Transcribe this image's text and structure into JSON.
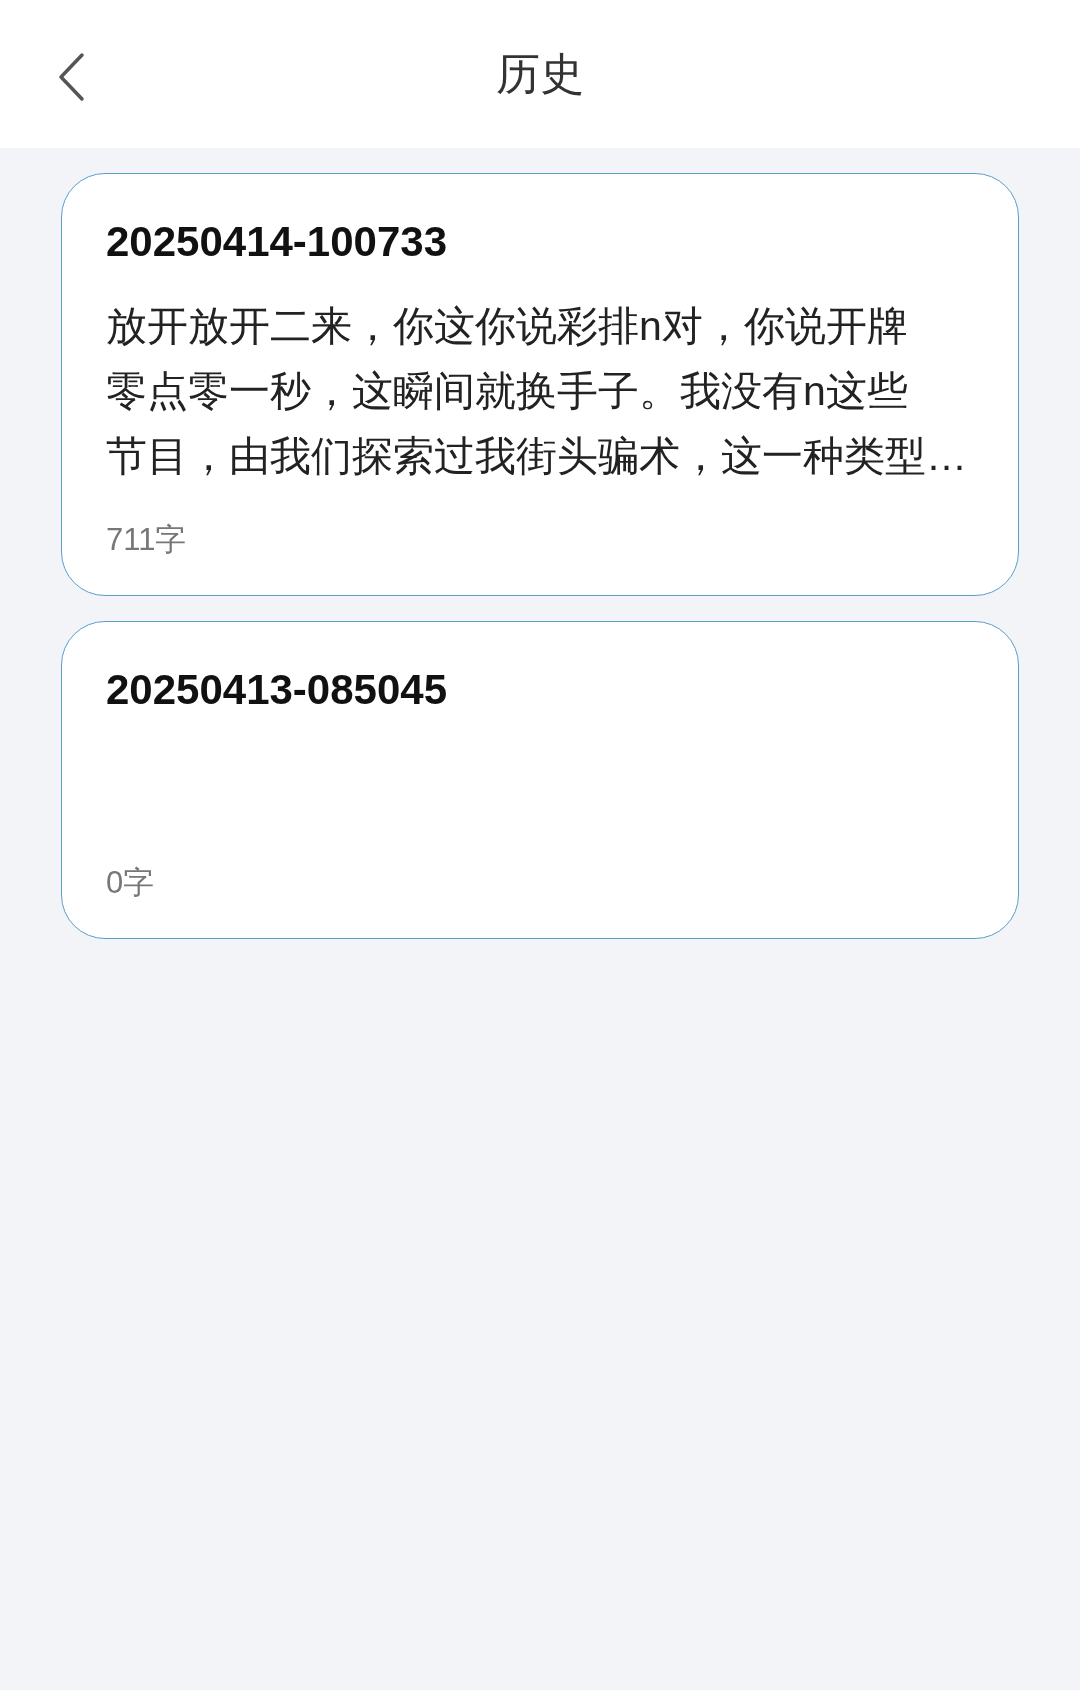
{
  "header": {
    "title": "历史"
  },
  "records": [
    {
      "name": "20250414-100733",
      "preview_lines": [
        "放开放开二来，你这你说彩排n对，你说开牌",
        "零点零一秒，这瞬间就换手子。我没有n这些",
        "节目，由我们探索过我街头骗术，这一种类型…"
      ],
      "count": "711字"
    },
    {
      "name": "20250413-085045",
      "count": "0字"
    }
  ]
}
